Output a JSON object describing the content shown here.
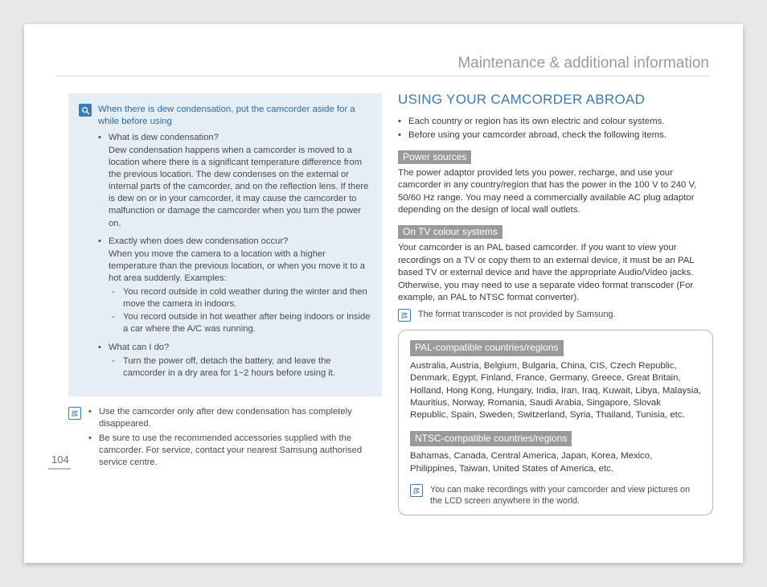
{
  "header": {
    "title": "Maintenance & additional information"
  },
  "page_number": "104",
  "left": {
    "dew_box": {
      "headline": "When there is dew condensation, put the camcorder aside for a while before using",
      "items": [
        {
          "q": "What is dew condensation?",
          "a": "Dew condensation happens when a camcorder is moved to a location where there is a significant temperature difference from the previous location. The dew condenses on the external or internal parts of the camcorder, and on the reflection lens. If there is dew on or in your camcorder, it may cause the camcorder to malfunction or damage the camcorder when you turn the power on."
        },
        {
          "q": "Exactly when does dew condensation occur?",
          "a": "When you move the camera to a location with a higher temperature than the previous location, or when you move it to a hot area suddenly. Examples:",
          "dashes": [
            "You record outside in cold weather during the winter and then move the camera in indoors.",
            "You record outside in hot weather after being indoors or inside a car where the A/C was running."
          ]
        },
        {
          "q": "What can I do?",
          "dashes": [
            "Turn the power off, detach the battery, and leave the camcorder in a dry area for 1~2 hours before using it."
          ]
        }
      ]
    },
    "note_items": [
      "Use the camcorder only after dew condensation has completely disappeared.",
      "Be sure to use the recommended accessories supplied with the camcorder. For service, contact your nearest Samsung authorised service centre."
    ]
  },
  "right": {
    "title": "USING YOUR CAMCORDER ABROAD",
    "intro": [
      "Each country or region has its own electric and colour systems.",
      "Before using your camcorder abroad, check the following items."
    ],
    "power_h": "Power sources",
    "power_p": "The power adaptor provided lets you power, recharge, and use your camcorder in any country/region that has the power in the 100 V to 240 V, 50/60 Hz range. You may need a commercially available AC plug adaptor depending on the design of local wall outlets.",
    "tv_h": "On TV colour systems",
    "tv_p": "Your camcorder is an PAL based camcorder. If you want to view your recordings on a TV or copy them to an external device, it must be an PAL based TV or external device and have the appropriate Audio/Video jacks. Otherwise, you may need to use a separate video format transcoder (For example, an PAL to NTSC format converter).",
    "tv_note": "The format transcoder is not provided by Samsung.",
    "pal_h": "PAL-compatible countries/regions",
    "pal_p": "Australia, Austria, Belgium, Bulgaria, China, CIS, Czech Republic, Denmark, Egypt, Finland, France, Germany, Greece, Great Britain, Holland, Hong Kong, Hungary, India, Iran, Iraq, Kuwait, Libya, Malaysia, Mauritius, Norway, Romania, Saudi Arabia, Singapore, Slovak Republic, Spain, Sweden, Switzerland, Syria, Thailand, Tunisia, etc.",
    "ntsc_h": "NTSC-compatible countries/regions",
    "ntsc_p": "Bahamas, Canada, Central America, Japan, Korea, Mexico, Philippines, Taiwan, United States of America, etc.",
    "box_note": "You can make recordings with your camcorder and view pictures on the LCD screen anywhere in the world."
  }
}
